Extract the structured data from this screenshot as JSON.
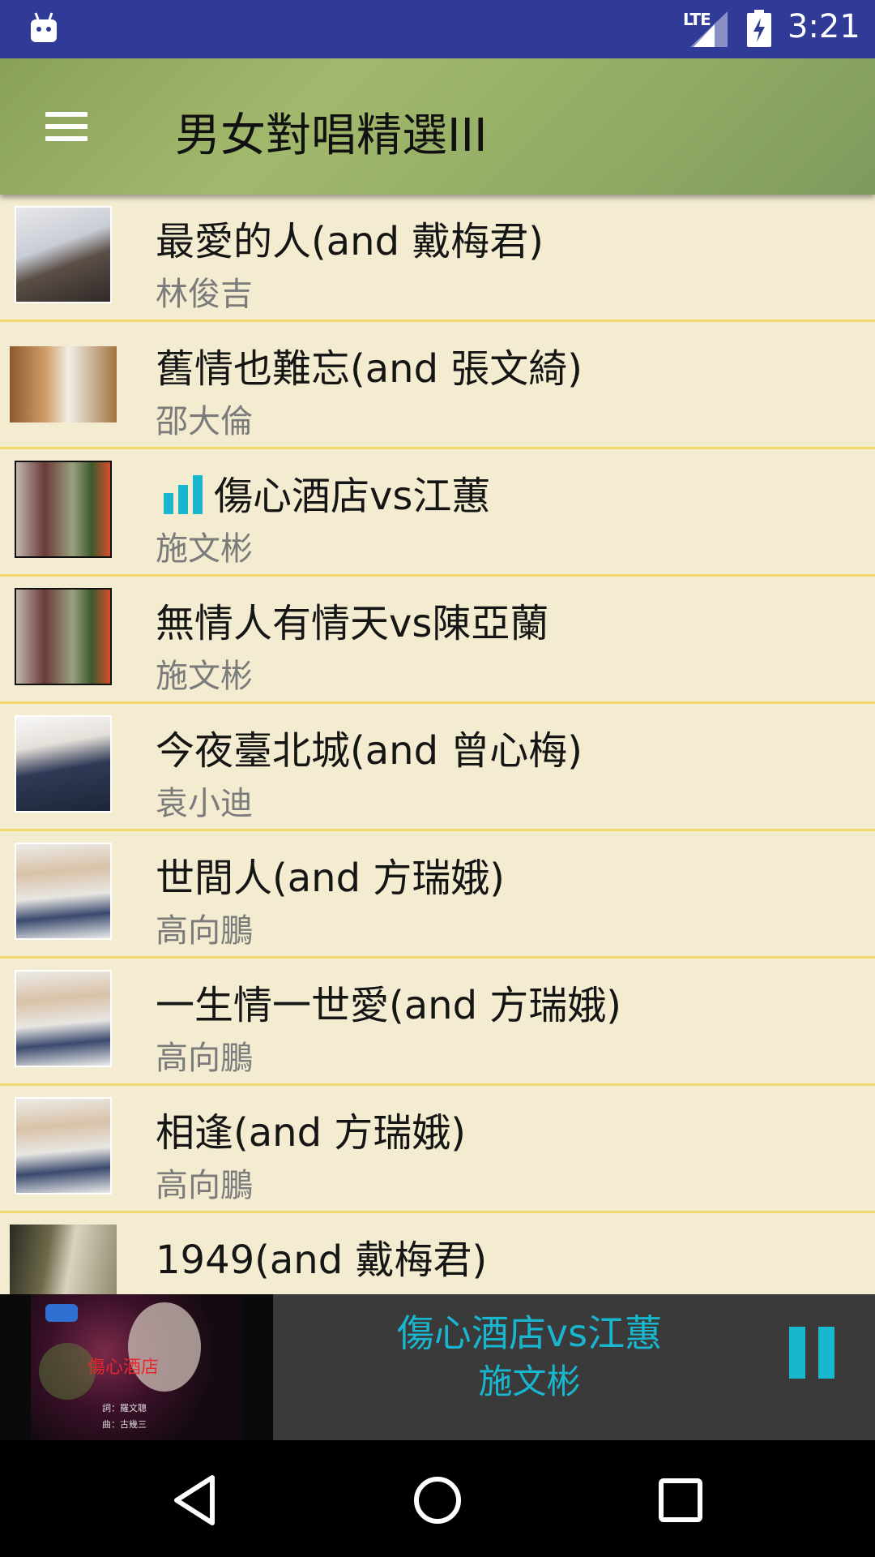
{
  "status_bar": {
    "network": "LTE",
    "time": "3:21"
  },
  "app_bar": {
    "title": "男女對唱精選III"
  },
  "songs": [
    {
      "title": "最愛的人(and 戴梅君)",
      "artist": "林俊吉"
    },
    {
      "title": "舊情也難忘(and 張文綺)",
      "artist": "邵大倫"
    },
    {
      "title": "傷心酒店vs江蕙",
      "artist": "施文彬",
      "playing": true
    },
    {
      "title": "無情人有情天vs陳亞蘭",
      "artist": "施文彬"
    },
    {
      "title": "今夜臺北城(and 曾心梅)",
      "artist": "袁小迪"
    },
    {
      "title": "世間人(and 方瑞娥)",
      "artist": "高向鵬"
    },
    {
      "title": "一生情一世愛(and 方瑞娥)",
      "artist": "高向鵬"
    },
    {
      "title": "相逢(and 方瑞娥)",
      "artist": "高向鵬"
    },
    {
      "title": "1949(and 戴梅君)",
      "artist": ""
    }
  ],
  "now_playing": {
    "title": "傷心酒店vs江蕙",
    "artist": "施文彬",
    "album_art_text": "傷心酒店",
    "album_credit_lyrics": "詞：羅文聰",
    "album_credit_music": "曲：古幾三",
    "accent_color": "#19b6cf"
  },
  "colors": {
    "status_bar": "#2f3b97",
    "list_background": "#f3ecd0",
    "row_divider": "#efd86c"
  }
}
